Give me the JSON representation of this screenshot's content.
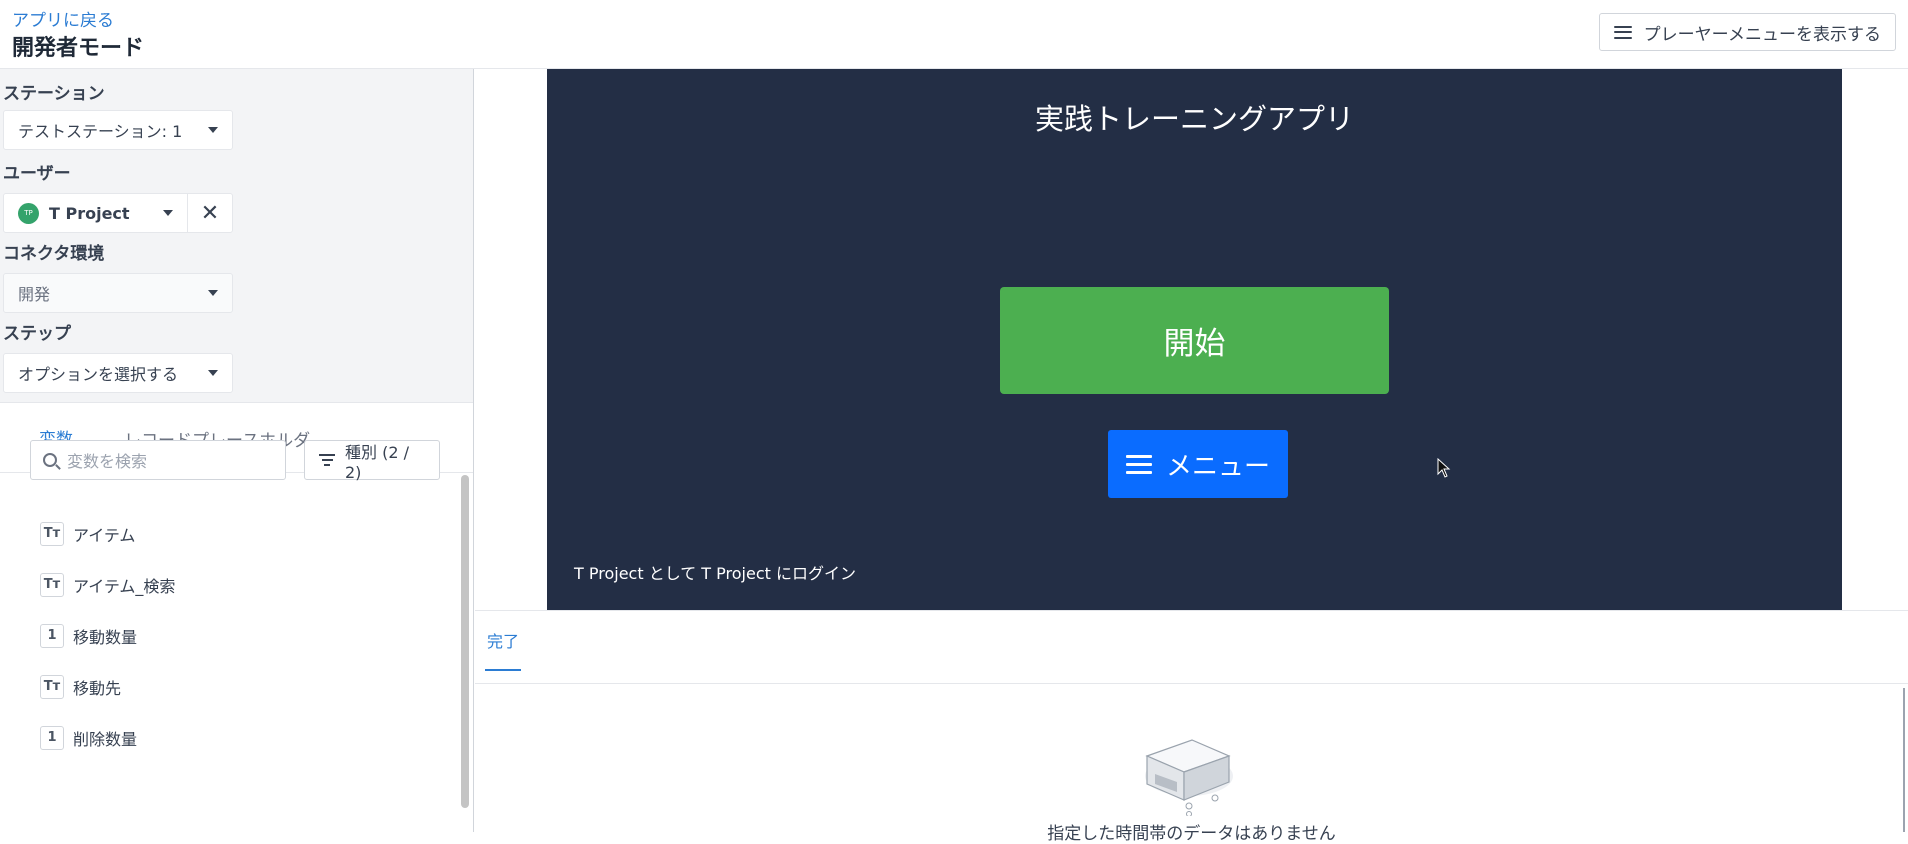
{
  "header": {
    "back_link": "アプリに戻る",
    "title": "開発者モード",
    "player_menu_label": "プレーヤーメニューを表示する"
  },
  "controls": {
    "station_label": "ステーション",
    "station_value": "テストステーション: 1",
    "user_label": "ユーザー",
    "user_avatar": "TP",
    "user_value": "T Project",
    "connector_label": "コネクタ環境",
    "connector_value": "開発",
    "step_label": "ステップ",
    "step_value": "オプションを選択する"
  },
  "tabs": {
    "variables": "変数",
    "record_placeholders": "レコードプレースホルダ"
  },
  "search": {
    "placeholder": "変数を検索"
  },
  "filter": {
    "label": "種別 (2 / 2)"
  },
  "variables": [
    {
      "type": "Tт",
      "name": "アイテム"
    },
    {
      "type": "Tт",
      "name": "アイテム_検索"
    },
    {
      "type": "1",
      "name": "移動数量"
    },
    {
      "type": "Tт",
      "name": "移動先"
    },
    {
      "type": "1",
      "name": "削除数量"
    }
  ],
  "app": {
    "title": "実践トレーニングアプリ",
    "start_button": "開始",
    "menu_button": "メニュー",
    "login_text": "T Project として T Project にログイン"
  },
  "bottom": {
    "tab_complete": "完了",
    "empty_message": "指定した時間帯のデータはありません"
  }
}
